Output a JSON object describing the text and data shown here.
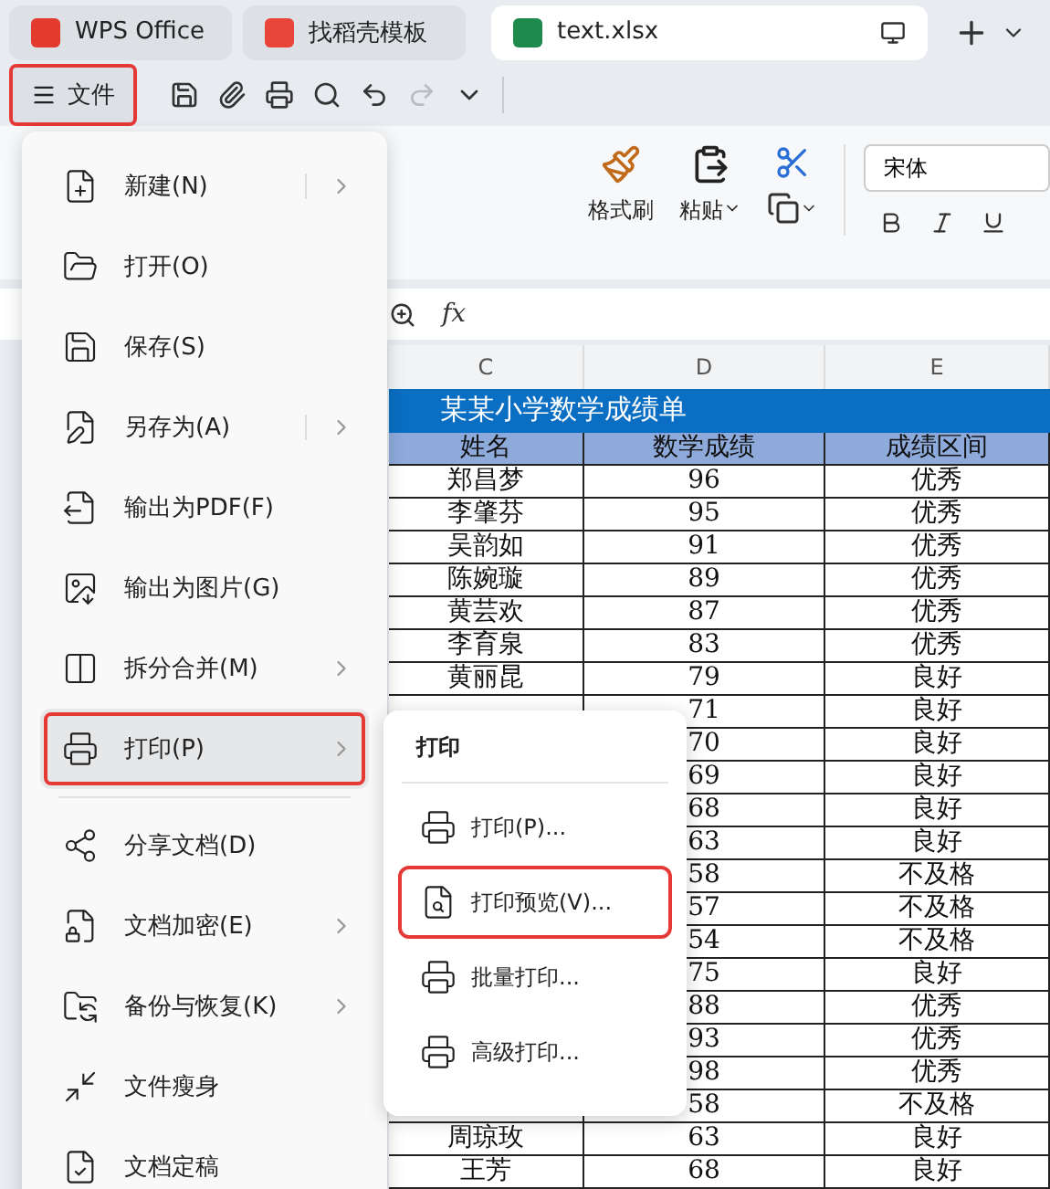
{
  "tabs": [
    {
      "label": "WPS Office",
      "selected": false
    },
    {
      "label": "找稻壳模板",
      "selected": false
    },
    {
      "label": "text.xlsx",
      "selected": true
    }
  ],
  "file_button": {
    "label": "文件",
    "highlighted": true
  },
  "quick_tools": [
    {
      "disabled": false
    },
    {
      "disabled": false
    },
    {
      "disabled": false
    },
    {
      "disabled": false
    },
    {
      "disabled": false
    },
    {
      "disabled": true
    },
    {
      "disabled": false
    }
  ],
  "ribbon": {
    "format_painter": "格式刷",
    "paste": "粘贴",
    "font": "宋体"
  },
  "formula_bar": {
    "fx": "fx"
  },
  "sheet": {
    "columns": [
      "C",
      "D",
      "E"
    ],
    "title": "某某小学数学成绩单",
    "headers": [
      "姓名",
      "数学成绩",
      "成绩区间"
    ],
    "rows": [
      {
        "name": "郑昌梦",
        "score": "96",
        "grade": "优秀"
      },
      {
        "name": "李肇芬",
        "score": "95",
        "grade": "优秀"
      },
      {
        "name": "吴韵如",
        "score": "91",
        "grade": "优秀"
      },
      {
        "name": "陈婉璇",
        "score": "89",
        "grade": "优秀"
      },
      {
        "name": "黄芸欢",
        "score": "87",
        "grade": "优秀"
      },
      {
        "name": "李育泉",
        "score": "83",
        "grade": "优秀"
      },
      {
        "name": "黄丽昆",
        "score": "79",
        "grade": "良好"
      },
      {
        "score": "71",
        "grade": "良好"
      },
      {
        "score": "70",
        "grade": "良好"
      },
      {
        "score": "69",
        "grade": "良好"
      },
      {
        "score": "68",
        "grade": "良好"
      },
      {
        "score": "63",
        "grade": "良好"
      },
      {
        "score": "58",
        "grade": "不及格"
      },
      {
        "score": "57",
        "grade": "不及格"
      },
      {
        "score": "54",
        "grade": "不及格"
      },
      {
        "score": "75",
        "grade": "良好"
      },
      {
        "score": "88",
        "grade": "优秀"
      },
      {
        "score": "93",
        "grade": "优秀"
      },
      {
        "score": "98",
        "grade": "优秀"
      },
      {
        "score": "58",
        "grade": "不及格"
      },
      {
        "name": "周琼玫",
        "score": "63",
        "grade": "良好"
      },
      {
        "name": "王芳",
        "score": "68",
        "grade": "良好"
      }
    ]
  },
  "file_menu": {
    "items": [
      {
        "label": "新建(N)",
        "submenu": true,
        "selected": false,
        "highlighted": false
      },
      {
        "label": "打开(O)",
        "submenu": false,
        "selected": false,
        "highlighted": false
      },
      {
        "label": "保存(S)",
        "submenu": false,
        "selected": false,
        "highlighted": false
      },
      {
        "label": "另存为(A)",
        "submenu": true,
        "selected": false,
        "highlighted": false
      },
      {
        "label": "输出为PDF(F)",
        "submenu": false,
        "selected": false,
        "highlighted": false
      },
      {
        "label": "输出为图片(G)",
        "submenu": false,
        "selected": false,
        "highlighted": false
      },
      {
        "label": "拆分合并(M)",
        "submenu": true,
        "selected": false,
        "highlighted": false
      },
      {
        "label": "打印(P)",
        "submenu": true,
        "selected": true,
        "highlighted": true
      },
      {
        "label": "分享文档(D)",
        "submenu": false,
        "selected": false,
        "highlighted": false
      },
      {
        "label": "文档加密(E)",
        "submenu": true,
        "selected": false,
        "highlighted": false
      },
      {
        "label": "备份与恢复(K)",
        "submenu": true,
        "selected": false,
        "highlighted": false
      },
      {
        "label": "文件瘦身",
        "submenu": false,
        "selected": false,
        "highlighted": false
      },
      {
        "label": "文档定稿",
        "submenu": false,
        "selected": false,
        "highlighted": false
      }
    ]
  },
  "print_submenu": {
    "title": "打印",
    "items": [
      {
        "label": "打印(P)...",
        "highlighted": false
      },
      {
        "label": "打印预览(V)...",
        "highlighted": true
      },
      {
        "label": "批量打印...",
        "highlighted": false
      },
      {
        "label": "高级打印...",
        "highlighted": false
      }
    ]
  }
}
